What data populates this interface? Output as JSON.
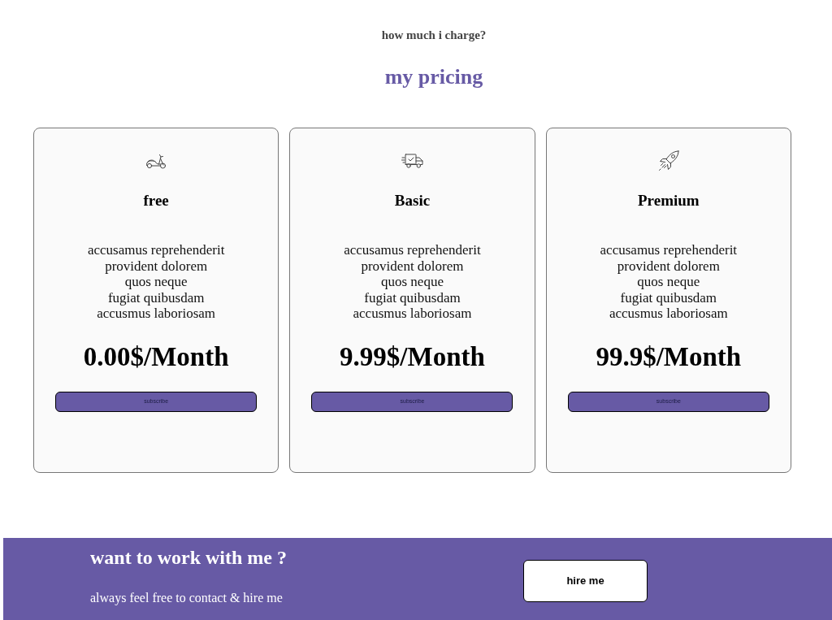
{
  "header": {
    "eyebrow": "how much i charge?",
    "title": "my pricing"
  },
  "plans": [
    {
      "name": "free",
      "features": [
        "accusamus reprehenderit",
        "provident dolorem",
        "quos neque",
        "fugiat quibusdam",
        "accusmus laboriosam"
      ],
      "price": "0.00$/Month",
      "button": "subscribe"
    },
    {
      "name": "Basic",
      "features": [
        "accusamus reprehenderit",
        "provident dolorem",
        "quos neque",
        "fugiat quibusdam",
        "accusmus laboriosam"
      ],
      "price": "9.99$/Month",
      "button": "subscribe"
    },
    {
      "name": "Premium",
      "features": [
        "accusamus reprehenderit",
        "provident dolorem",
        "quos neque",
        "fugiat quibusdam",
        "accusmus laboriosam"
      ],
      "price": "99.9$/Month",
      "button": "subscribe"
    }
  ],
  "cta": {
    "title": "want to work with me ?",
    "subtitle": "always feel free to contact & hire me",
    "button": "hire me"
  }
}
